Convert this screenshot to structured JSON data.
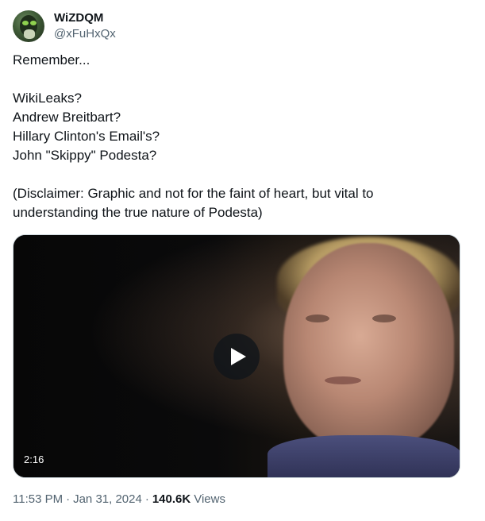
{
  "author": {
    "display_name": "WiZDQM",
    "handle": "@xFuHxQx",
    "avatar_icon": "avatar-image"
  },
  "tweet": {
    "lines": [
      "Remember...",
      "",
      "WikiLeaks?",
      "Andrew Breitbart?",
      "Hillary Clinton's Email's?",
      "John \"Skippy\" Podesta?",
      "",
      "(Disclaimer: Graphic and not for the faint of heart, but vital to",
      "understanding the true nature of Podesta)"
    ]
  },
  "media": {
    "type": "video",
    "duration": "2:16",
    "play_icon": "play-icon"
  },
  "meta": {
    "time": "11:53 PM",
    "separator": "·",
    "date": "Jan 31, 2024",
    "views_count": "140.6K",
    "views_label": "Views"
  },
  "colors": {
    "text_primary": "#0f1419",
    "text_secondary": "#536471",
    "border": "#cfd9de"
  }
}
